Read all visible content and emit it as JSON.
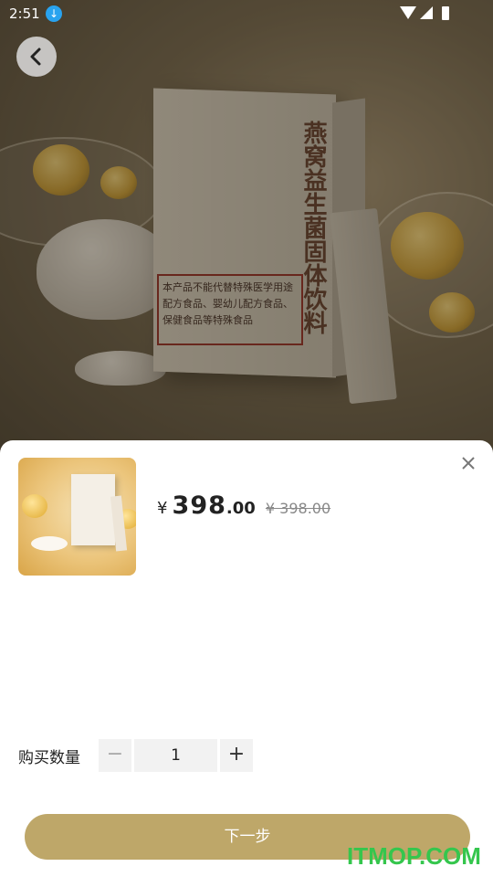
{
  "status_bar": {
    "time": "2:51"
  },
  "hero": {
    "box_title": "燕窝益生菌固体饮料",
    "warning_text": "本产品不能代替特殊医学用途配方食品、婴幼儿配方食品、保健食品等特殊食品"
  },
  "product": {
    "currency": "¥",
    "price_int": "398",
    "price_dec": ".00",
    "original_price": "¥ 398.00"
  },
  "quantity": {
    "label": "购买数量",
    "value": "1",
    "minus": "−",
    "plus": "+"
  },
  "actions": {
    "next_label": "下一步"
  },
  "watermark": "ITMOP.COM",
  "colors": {
    "accent": "#bea769",
    "watermark": "#35c64d",
    "download": "#29a3ef"
  },
  "icons": [
    "back-icon",
    "close-icon",
    "download-icon",
    "wifi-icon",
    "signal-icon",
    "battery-icon"
  ]
}
